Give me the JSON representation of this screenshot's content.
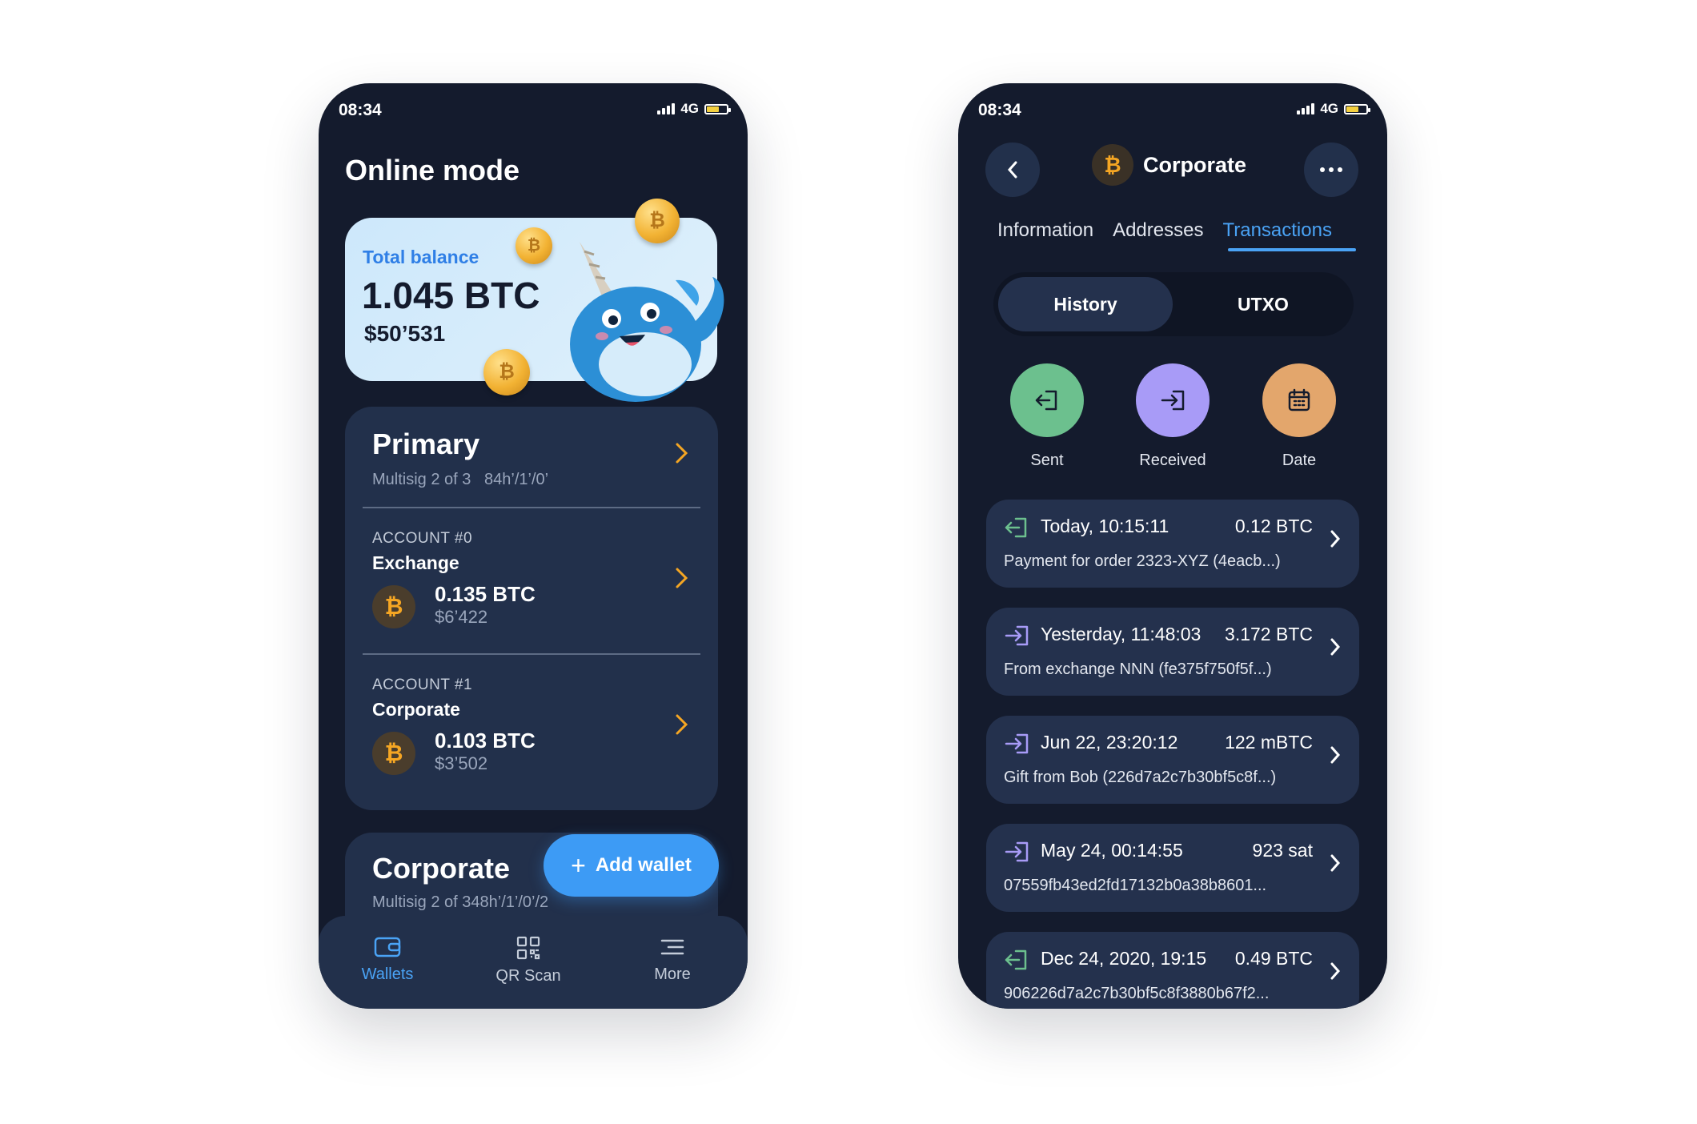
{
  "status": {
    "time": "08:34",
    "network": "4G"
  },
  "left": {
    "title": "Online mode",
    "balance": {
      "label": "Total balance",
      "btc": "1.045 BTC",
      "usd": "$50’531"
    },
    "primary_wallet": {
      "name": "Primary",
      "subtitle": "Multisig 2 of 3   84h’/1’/0’",
      "accounts": [
        {
          "label": "ACCOUNT #0",
          "name": "Exchange",
          "btc": "0.135 BTC",
          "usd": "$6’422",
          "badge": "₿"
        },
        {
          "label": "ACCOUNT #1",
          "name": "Corporate",
          "btc": "0.103 BTC",
          "usd": "$3’502",
          "badge": "₿"
        }
      ]
    },
    "second_wallet": {
      "name": "Corporate",
      "subtitle": "Multisig 2 of 348h’/1’/0’/2"
    },
    "add_wallet": {
      "icon": "+",
      "label": "Add wallet"
    },
    "tabbar": [
      {
        "label": "Wallets",
        "icon": "wallet-icon"
      },
      {
        "label": "QR Scan",
        "icon": "qr-icon"
      },
      {
        "label": "More",
        "icon": "menu-icon"
      }
    ]
  },
  "right": {
    "header": {
      "badge": "₿",
      "title": "Corporate"
    },
    "tabs": [
      "Information",
      "Addresses",
      "Transactions"
    ],
    "segments": [
      "History",
      "UTXO"
    ],
    "filters": [
      {
        "label": "Sent",
        "color": "#6cc08e"
      },
      {
        "label": "Received",
        "color": "#a89bf7"
      },
      {
        "label": "Date",
        "color": "#e3a66c"
      }
    ],
    "transactions": [
      {
        "type": "sent",
        "date": "Today, 10:15:11",
        "amount": "0.12 BTC",
        "desc": "Payment for order 2323-XYZ (4eacb...)"
      },
      {
        "type": "received",
        "date": "Yesterday, 11:48:03",
        "amount": "3.172 BTC",
        "desc": "From exchange NNN (fe375f750f5f...)"
      },
      {
        "type": "received",
        "date": "Jun 22, 23:20:12",
        "amount": "122 mBTC",
        "desc": "Gift from Bob (226d7a2c7b30bf5c8f...)"
      },
      {
        "type": "received",
        "date": "May 24, 00:14:55",
        "amount": "923 sat",
        "desc": "07559fb43ed2fd17132b0a38b8601..."
      },
      {
        "type": "sent",
        "date": "Dec 24, 2020, 19:15",
        "amount": "0.49 BTC",
        "desc": "906226d7a2c7b30bf5c8f3880b67f2..."
      }
    ],
    "colors": {
      "sent": "#6cc08e",
      "received": "#a89bf7",
      "accent": "#4aa3f5"
    }
  }
}
